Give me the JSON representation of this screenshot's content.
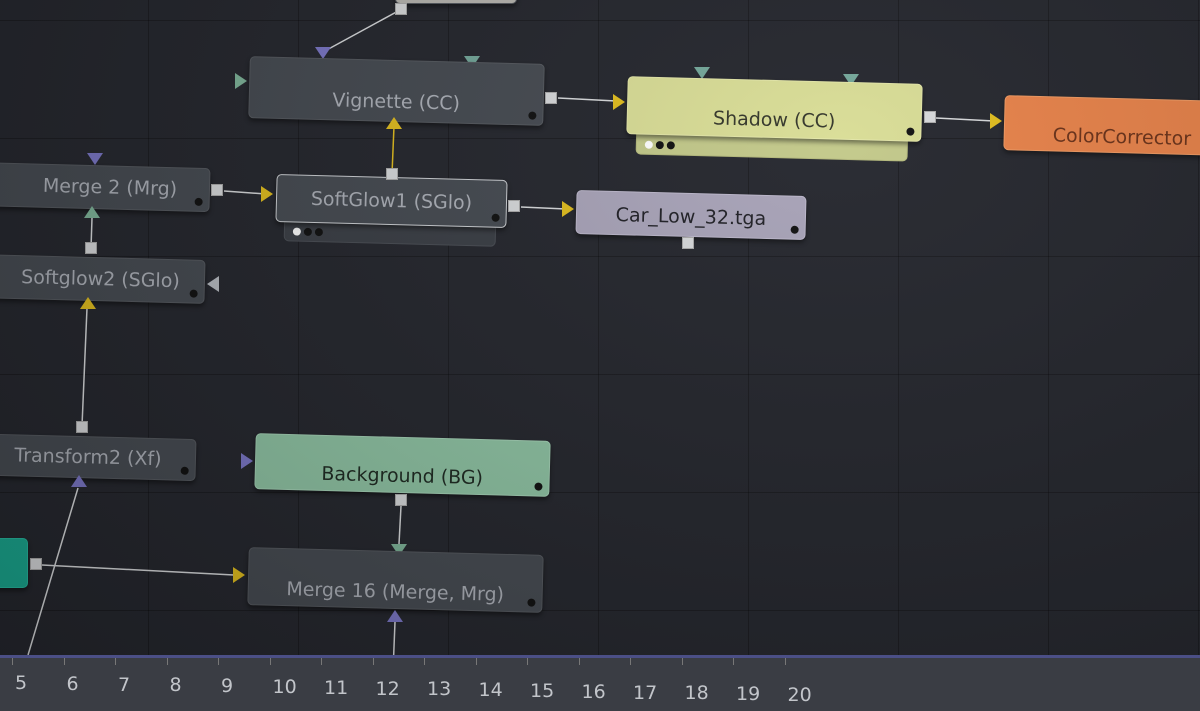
{
  "flow": {
    "nodes": {
      "top_partial": "",
      "vignette": "Vignette (CC)",
      "shadow": "Shadow (CC)",
      "color_corrector": "ColorCorrector",
      "merge2": "Merge 2 (Mrg)",
      "softglow1": "SoftGlow1 (SGlo)",
      "car_low": "Car_Low_32.tga",
      "softglow2": "Softglow2 (SGlo)",
      "transform2": "Transform2 (Xf)",
      "background": "Background (BG)",
      "merge16": "Merge 16 (Merge, Mrg)"
    },
    "colors": {
      "canvas": "#25272e",
      "node_default": "#464b52",
      "shadow_node": "#d9dd96",
      "color_corrector_node": "#e9834a",
      "car_low_node": "#a9a4b9",
      "background_node": "#8fc4a4",
      "teal_node": "#1aa890",
      "input_yellow": "#e2be1e",
      "input_purple": "#7b77c7",
      "input_green": "#7fb59a"
    }
  },
  "timeline": {
    "ticks": [
      "5",
      "6",
      "7",
      "8",
      "9",
      "10",
      "11",
      "12",
      "13",
      "14",
      "15",
      "16",
      "17",
      "18",
      "19",
      "20"
    ]
  }
}
